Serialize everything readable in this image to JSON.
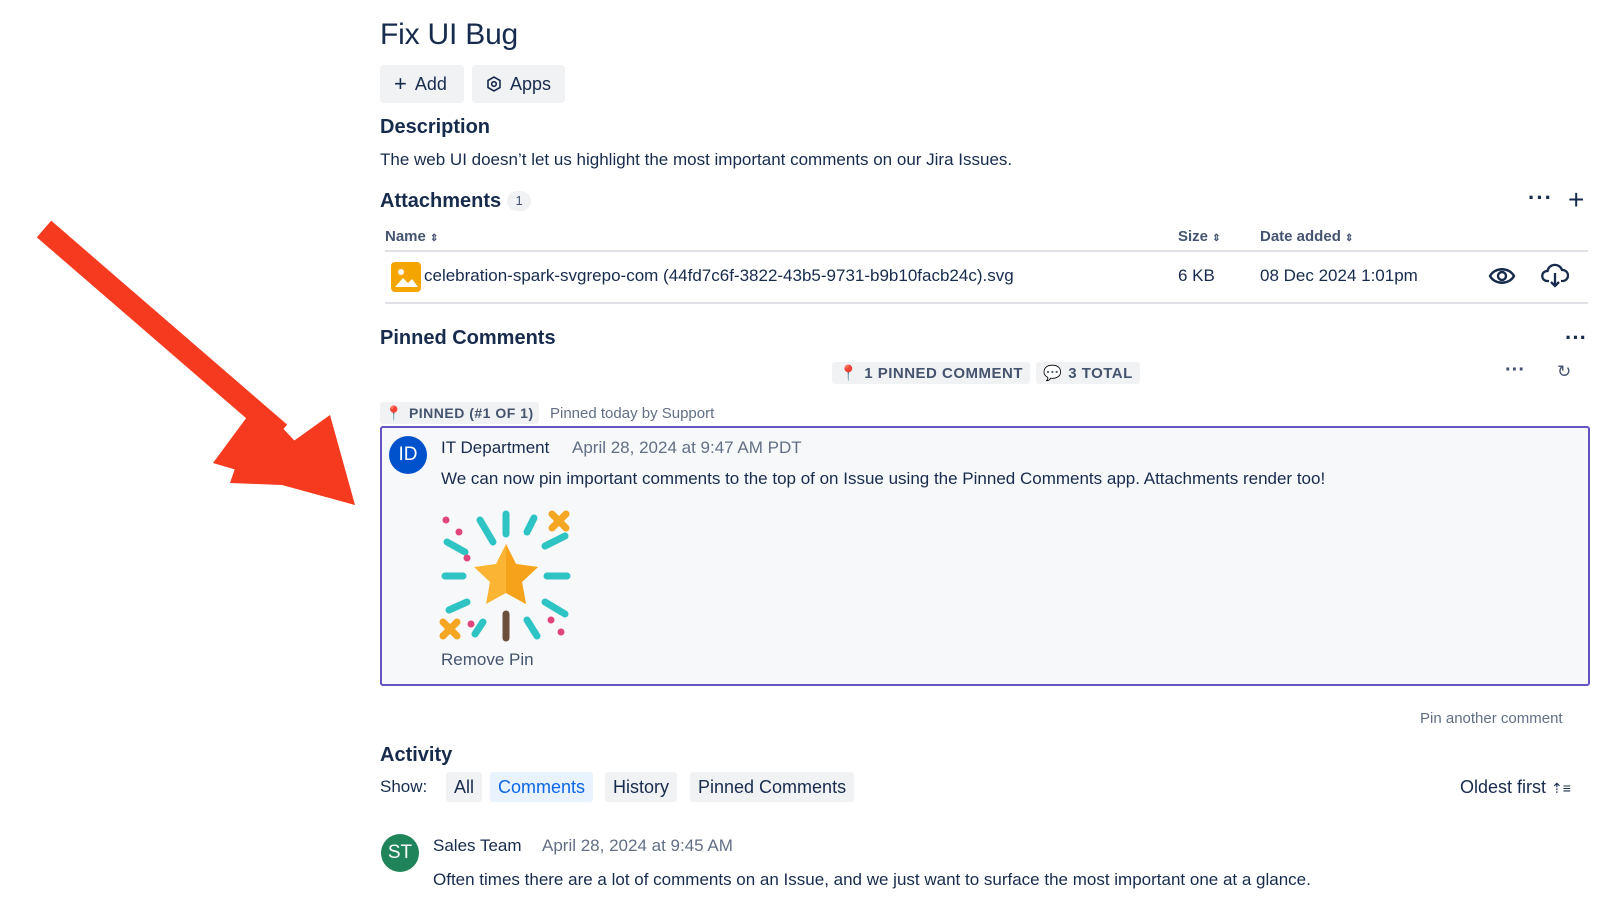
{
  "issue": {
    "title": "Fix UI Bug",
    "add_label": "Add",
    "apps_label": "Apps"
  },
  "description": {
    "heading": "Description",
    "text": "The web UI doesn’t let us highlight the most important comments on our Jira Issues."
  },
  "attachments": {
    "heading": "Attachments",
    "count": "1",
    "columns": [
      "Name",
      "Size",
      "Date added"
    ],
    "rows": [
      {
        "name": "celebration-spark-svgrepo-com (44fd7c6f-3822-43b5-9731-b9b10facb24c).svg",
        "size": "6 KB",
        "date": "08 Dec 2024 1:01pm"
      }
    ]
  },
  "pinned": {
    "heading": "Pinned Comments",
    "pinned_count_label": "1 PINNED COMMENT",
    "total_label": "3 TOTAL",
    "pin_lozenge": "PINNED (#1 OF 1)",
    "pin_meta": "Pinned today by Support",
    "comment": {
      "avatar_initials": "ID",
      "author": "IT Department",
      "timestamp": "April 28, 2024 at 9:47 AM PDT",
      "text": "We can now pin important comments to the top of on Issue using the Pinned Comments app. Attachments render too!",
      "remove_label": "Remove Pin"
    },
    "pin_another_label": "Pin another comment"
  },
  "activity": {
    "heading": "Activity",
    "show_label": "Show:",
    "filters": [
      "All",
      "Comments",
      "History",
      "Pinned Comments"
    ],
    "active_filter": "Comments",
    "sort_label": "Oldest first",
    "comments": [
      {
        "avatar_initials": "ST",
        "author": "Sales Team",
        "timestamp": "April 28, 2024 at 9:45 AM",
        "text": "Often times there are a lot of comments on an Issue, and we just want to surface the most important one at a glance."
      }
    ]
  },
  "colors": {
    "annotation_arrow": "#f53a1f",
    "pinned_border": "#6554c0",
    "avatar_it": "#0052cc",
    "avatar_sales": "#1f845a",
    "active_filter_text": "#0c66e4"
  },
  "icons": [
    "plus-icon",
    "apps-icon",
    "image-file-icon",
    "eye-icon",
    "cloud-download-icon",
    "more-icon",
    "pin-icon",
    "comment-bubble-icon",
    "refresh-icon",
    "sort-icon",
    "celebration-spark-icon",
    "red-arrow"
  ]
}
